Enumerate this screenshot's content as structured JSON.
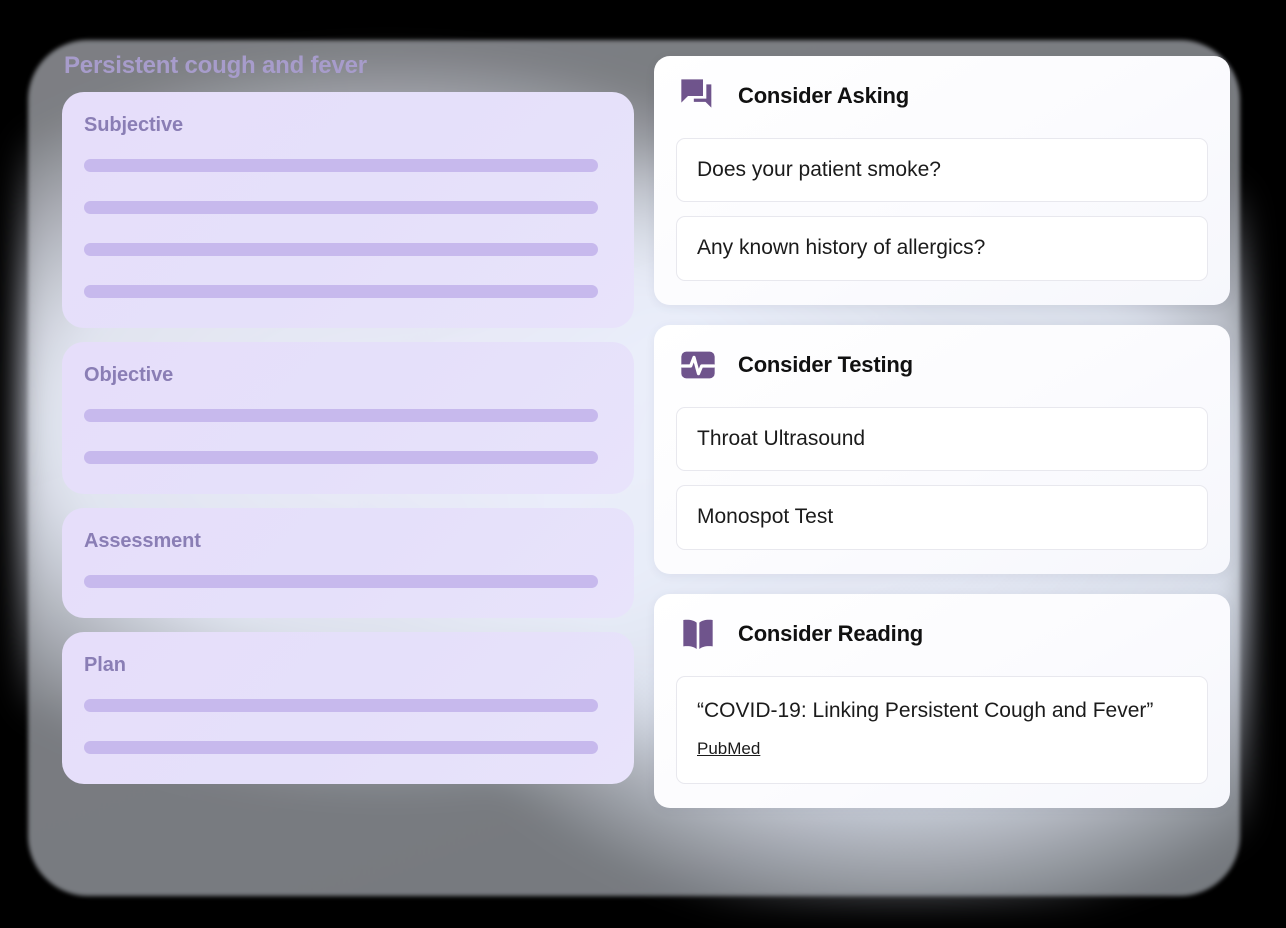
{
  "theme": {
    "accent_purple": "#6f548c",
    "soap_card_bg": "#e6defa",
    "soap_line": "#c7b9ed",
    "soap_heading": "#8a7eb5",
    "note_title_color": "#a79ccb",
    "page_bg": "#000000",
    "card_bg": "#ffffff"
  },
  "note": {
    "title": "Persistent cough and fever",
    "sections": [
      {
        "heading": "Subjective",
        "placeholder_lines": 4
      },
      {
        "heading": "Objective",
        "placeholder_lines": 2
      },
      {
        "heading": "Assessment",
        "placeholder_lines": 1
      },
      {
        "heading": "Plan",
        "placeholder_lines": 2
      }
    ]
  },
  "suggestions": {
    "cards": [
      {
        "title": "Consider Asking",
        "icon": "chat-bubbles-icon",
        "items": [
          {
            "text": "Does your patient smoke?"
          },
          {
            "text": "Any known history of allergics?"
          }
        ]
      },
      {
        "title": "Consider Testing",
        "icon": "pulse-monitor-icon",
        "items": [
          {
            "text": "Throat Ultrasound"
          },
          {
            "text": "Monospot Test"
          }
        ]
      },
      {
        "title": "Consider Reading",
        "icon": "open-book-icon",
        "items": [
          {
            "text": "“COVID-19: Linking Persistent Cough and Fever”",
            "source": "PubMed"
          }
        ]
      }
    ]
  }
}
